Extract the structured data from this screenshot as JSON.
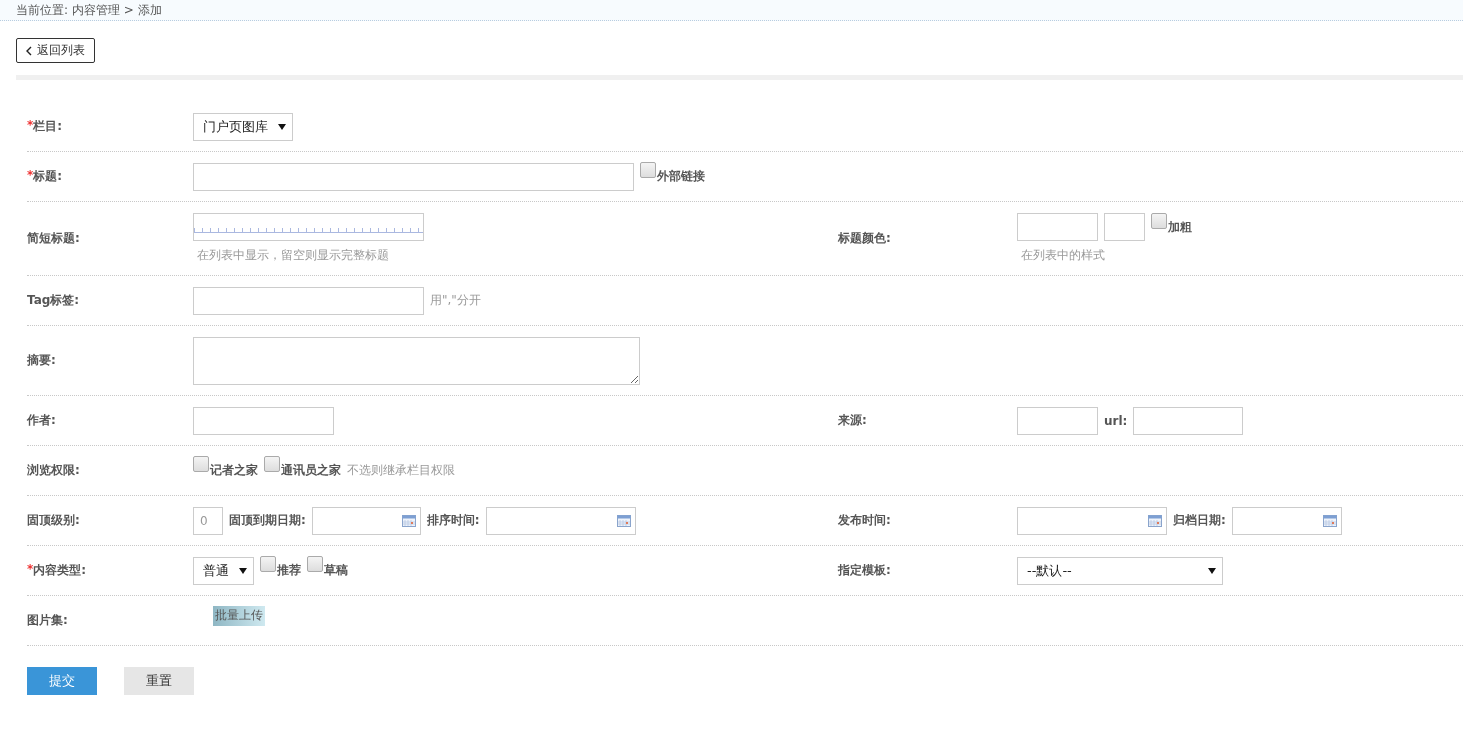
{
  "breadcrumb": "当前位置: 内容管理 > 添加",
  "back_button": "返回列表",
  "rows": [
    {
      "left": {
        "label": "栏目:",
        "marker": "*",
        "controls": [
          {
            "kind": "select",
            "value": "门户页图库"
          }
        ]
      }
    },
    {
      "left": {
        "label": "标题:",
        "marker": "*",
        "controls": [
          {
            "kind": "text"
          },
          {
            "kind": "checkbox",
            "label": "外部链接",
            "checked": false
          }
        ]
      }
    },
    {
      "left": {
        "label": "简短标题:",
        "controls": [
          {
            "kind": "ruler"
          }
        ],
        "note": "在列表中显示，留空则显示完整标题"
      },
      "right": {
        "label": "标题颜色:",
        "controls": [
          {
            "kind": "text"
          },
          {
            "kind": "text"
          },
          {
            "kind": "checkbox",
            "label": "加粗",
            "checked": false
          }
        ],
        "note": "在列表中的样式"
      }
    },
    {
      "left": {
        "label": "Tag标签:",
        "controls": [
          {
            "kind": "text"
          },
          {
            "kind": "hint",
            "text": "用\",\"分开"
          }
        ]
      }
    },
    {
      "left": {
        "label": "摘要:",
        "controls": [
          {
            "kind": "textarea"
          }
        ]
      }
    },
    {
      "left": {
        "label": "作者:",
        "controls": [
          {
            "kind": "text"
          }
        ]
      },
      "right": {
        "label": "来源:",
        "controls": [
          {
            "kind": "text"
          },
          {
            "kind": "label",
            "text": "url:"
          },
          {
            "kind": "text"
          }
        ]
      }
    },
    {
      "left": {
        "label": "浏览权限:",
        "controls": [
          {
            "kind": "checkbox",
            "label": "记者之家",
            "checked": false
          },
          {
            "kind": "checkbox",
            "label": "通讯员之家",
            "checked": false
          },
          {
            "kind": "hint",
            "text": "不选则继承栏目权限"
          }
        ]
      }
    },
    {
      "left": {
        "label": "固顶级别:",
        "controls": [
          {
            "kind": "text",
            "placeholder": "0"
          },
          {
            "kind": "label",
            "text": "固顶到期日期:"
          },
          {
            "kind": "date"
          },
          {
            "kind": "label",
            "text": "排序时间:"
          },
          {
            "kind": "date"
          }
        ]
      },
      "right": {
        "label": "发布时间:",
        "controls": [
          {
            "kind": "date"
          },
          {
            "kind": "label",
            "text": "归档日期:"
          },
          {
            "kind": "date"
          }
        ]
      }
    },
    {
      "left": {
        "label": "内容类型:",
        "marker": "*",
        "controls": [
          {
            "kind": "select",
            "value": "普通"
          },
          {
            "kind": "checkbox",
            "label": "推荐",
            "checked": false
          },
          {
            "kind": "checkbox",
            "label": "草稿",
            "checked": false
          }
        ]
      },
      "right": {
        "label": "指定模板:",
        "controls": [
          {
            "kind": "select",
            "value": "--默认--"
          }
        ]
      }
    },
    {
      "left": {
        "label": "图片集:",
        "controls": [
          {
            "kind": "upload",
            "text": "批量上传"
          }
        ]
      }
    }
  ],
  "buttons": [
    {
      "label": "提交",
      "kind": "primary"
    },
    {
      "label": "重置",
      "kind": "secondary"
    }
  ]
}
